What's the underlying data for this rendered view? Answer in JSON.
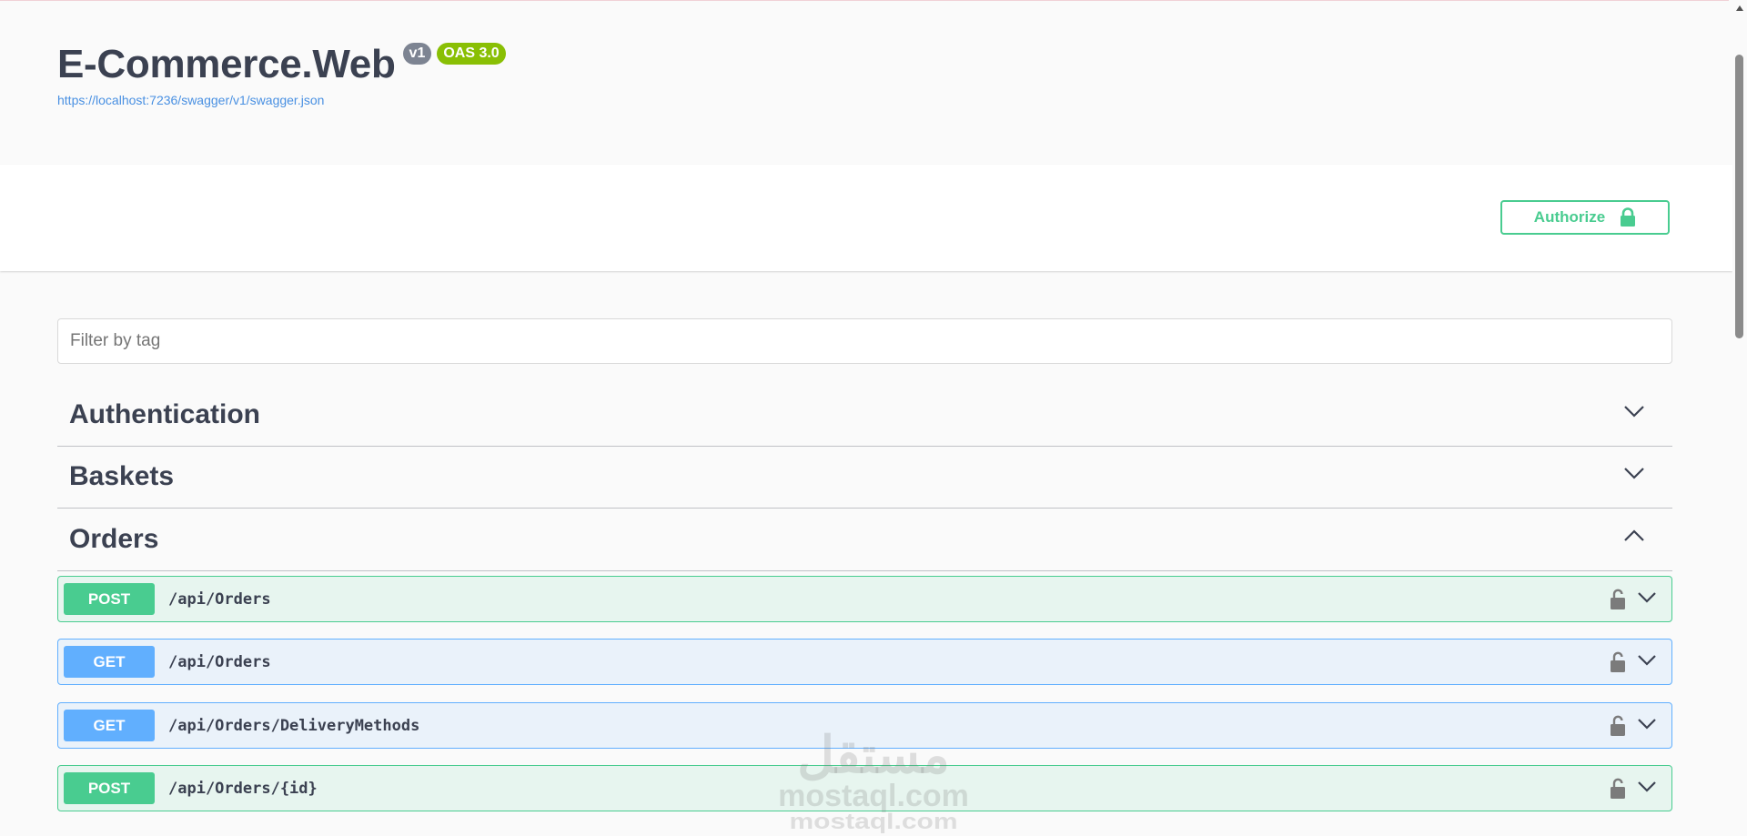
{
  "info": {
    "title": "E-Commerce.Web",
    "version": "v1",
    "oas_version": "OAS 3.0",
    "spec_url": "https://localhost:7236/swagger/v1/swagger.json"
  },
  "authorize": {
    "label": "Authorize",
    "icon": "lock-icon",
    "color": "#49cc90"
  },
  "filter": {
    "placeholder": "Filter by tag",
    "value": ""
  },
  "tags": [
    {
      "name": "Authentication",
      "expanded": false
    },
    {
      "name": "Baskets",
      "expanded": false
    },
    {
      "name": "Orders",
      "expanded": true
    }
  ],
  "operations": [
    {
      "method": "POST",
      "path": "/api/Orders",
      "locked": true
    },
    {
      "method": "GET",
      "path": "/api/Orders",
      "locked": true
    },
    {
      "method": "GET",
      "path": "/api/Orders/DeliveryMethods",
      "locked": true
    },
    {
      "method": "POST",
      "path": "/api/Orders/{id}",
      "locked": true
    }
  ],
  "colors": {
    "post": "#49cc90",
    "get": "#61affe",
    "version_badge": "#7d8492",
    "oas_badge": "#89bf04",
    "link": "#4990e2"
  },
  "watermark": {
    "mark": "مستقل",
    "domain": "mostaql.com",
    "domain_mirror": "mostaql.com"
  }
}
